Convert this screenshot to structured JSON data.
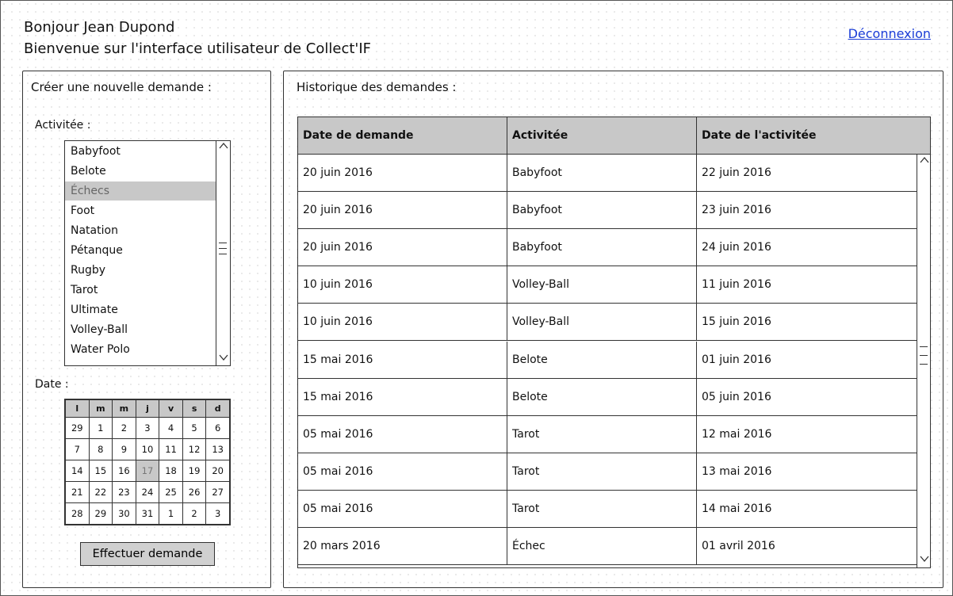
{
  "header": {
    "greeting": "Bonjour Jean Dupond",
    "welcome": "Bienvenue sur l'interface utilisateur de Collect'IF",
    "logout_label": "Déconnexion"
  },
  "new_request": {
    "title": "Créer une nouvelle demande :",
    "activity_label": "Activitée :",
    "activities": [
      "Babyfoot",
      "Belote",
      "Échecs",
      "Foot",
      "Natation",
      "Pétanque",
      "Rugby",
      "Tarot",
      "Ultimate",
      "Volley-Ball",
      "Water Polo"
    ],
    "selected_activity": "Échecs",
    "date_label": "Date :",
    "calendar": {
      "weekdays": [
        "l",
        "m",
        "m",
        "j",
        "v",
        "s",
        "d"
      ],
      "weeks": [
        [
          "29",
          "1",
          "2",
          "3",
          "4",
          "5",
          "6"
        ],
        [
          "7",
          "8",
          "9",
          "10",
          "11",
          "12",
          "13"
        ],
        [
          "14",
          "15",
          "16",
          "17",
          "18",
          "19",
          "20"
        ],
        [
          "21",
          "22",
          "23",
          "24",
          "25",
          "26",
          "27"
        ],
        [
          "28",
          "29",
          "30",
          "31",
          "1",
          "2",
          "3"
        ]
      ],
      "selected_day": "17"
    },
    "submit_label": "Effectuer demande"
  },
  "history": {
    "title": "Historique des demandes :",
    "columns": [
      "Date de demande",
      "Activitée",
      "Date de l'activitée"
    ],
    "rows": [
      [
        "20 juin 2016",
        "Babyfoot",
        "22 juin 2016"
      ],
      [
        "20 juin 2016",
        "Babyfoot",
        "23 juin 2016"
      ],
      [
        "20 juin 2016",
        "Babyfoot",
        "24 juin 2016"
      ],
      [
        "10 juin 2016",
        "Volley-Ball",
        "11 juin 2016"
      ],
      [
        "10 juin 2016",
        "Volley-Ball",
        "15 juin 2016"
      ],
      [
        "15 mai 2016",
        "Belote",
        "01 juin 2016"
      ],
      [
        "15 mai 2016",
        "Belote",
        "05 juin 2016"
      ],
      [
        "05 mai 2016",
        "Tarot",
        "12 mai 2016"
      ],
      [
        "05 mai 2016",
        "Tarot",
        "13 mai 2016"
      ],
      [
        "05 mai 2016",
        "Tarot",
        "14 mai 2016"
      ],
      [
        "20 mars 2016",
        "Échec",
        "01 avril 2016"
      ]
    ]
  },
  "icons": {
    "scroll_up": "chevron-up-icon",
    "scroll_down": "chevron-down-icon",
    "scroll_thumb": "scroll-thumb-icon"
  }
}
